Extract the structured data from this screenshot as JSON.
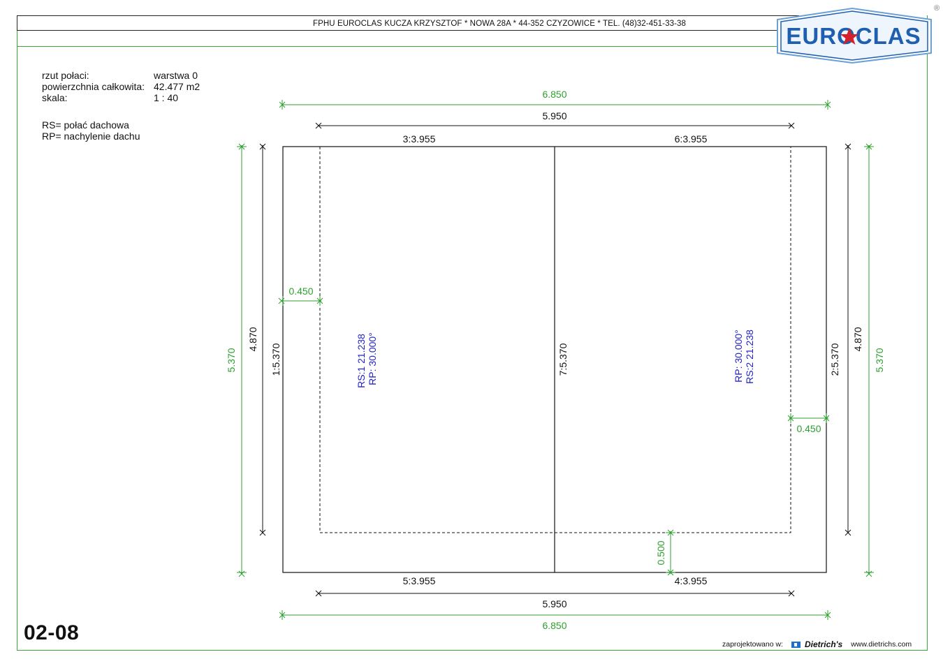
{
  "header": {
    "company_line": "FPHU EUROCLAS KUCZA KRZYSZTOF * NOWA 28A * 44-352 CZYZOWICE * TEL. (48)32-451-33-38",
    "logo_text": "EUROCLAS",
    "registered_mark": "®"
  },
  "info": {
    "rows": [
      {
        "label": "rzut połaci:",
        "value": "warstwa 0"
      },
      {
        "label": "powierzchnia całkowita:",
        "value": "42.477 m2"
      },
      {
        "label": "skala:",
        "value": "1 : 40"
      }
    ],
    "legend": [
      "RS= połać dachowa",
      "RP= nachylenie dachu"
    ]
  },
  "dimensions": {
    "overall_width_top": "6.850",
    "inner_width_top": "5.950",
    "edge_3": "3:3.955",
    "edge_6": "6:3.955",
    "edge_5": "5:3.955",
    "edge_4": "4:3.955",
    "inner_width_bottom": "5.950",
    "overall_width_bottom": "6.850",
    "left_overall": "5.370",
    "left_inner": "4.870",
    "edge_1": "1:5.370",
    "ridge_7": "7:5.370",
    "edge_2": "2:5.370",
    "right_inner": "4.870",
    "right_overall": "5.370",
    "overhang_left": "0.450",
    "overhang_right": "0.450",
    "overhang_bottom": "0.500"
  },
  "planes": {
    "left": {
      "rs": "RS:1   21.238",
      "rp": "RP:   30.000°"
    },
    "right": {
      "rp": "RP:   30.000°",
      "rs": "RS:2   21.238"
    }
  },
  "colors": {
    "dimension_green": "#2ea02e",
    "plane_label_blue": "#2323c8",
    "logo_blue": "#1f5fb0",
    "logo_red": "#d4202a"
  },
  "sheet": {
    "id": "02-08"
  },
  "footer": {
    "designed_with": "zaprojektowano w:",
    "software": "Dietrich's",
    "url": "www.dietrichs.com"
  }
}
